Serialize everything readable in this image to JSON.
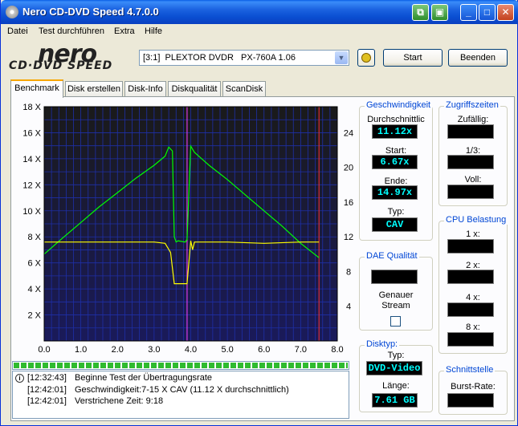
{
  "window": {
    "title": "Nero CD-DVD Speed 4.7.0.0"
  },
  "menu": [
    "Datei",
    "Test durchführen",
    "Extra",
    "Hilfe"
  ],
  "logo": {
    "line1": "nero",
    "line2": "CD·DVD SPEED"
  },
  "toolbar": {
    "drive": "[3:1]  PLEXTOR DVDR   PX-760A 1.06",
    "start": "Start",
    "quit": "Beenden"
  },
  "tabs": [
    "Benchmark",
    "Disk erstellen",
    "Disk-Info",
    "Diskqualität",
    "ScanDisk"
  ],
  "speed": {
    "title": "Geschwindigkeit",
    "avg_label": "Durchschnittlic",
    "avg": "11.12x",
    "start_label": "Start:",
    "start": "6.67x",
    "end_label": "Ende:",
    "end": "14.97x",
    "type_label": "Typ:",
    "type": "CAV"
  },
  "access": {
    "title": "Zugriffszeiten",
    "random": "Zufällig:",
    "third": "1/3:",
    "full": "Voll:"
  },
  "cpu": {
    "title": "CPU Belastung",
    "x1": "1 x:",
    "x2": "2 x:",
    "x4": "4 x:",
    "x8": "8 x:"
  },
  "dae": {
    "title": "DAE Qualität",
    "stream_label": "Genauer\nStream"
  },
  "disc": {
    "title": "Disktyp:",
    "type_label": "Typ:",
    "type": "DVD-Video",
    "length_label": "Länge:",
    "length": "7.61 GB"
  },
  "interface": {
    "title": "Schnittstelle",
    "burst": "Burst-Rate:"
  },
  "log": [
    {
      "time": "[12:32:43]",
      "msg": "Beginne Test der Übertragungsrate"
    },
    {
      "time": "[12:42:01]",
      "msg": "Geschwindigkeit:7-15 X CAV (11.12 X durchschnittlich)"
    },
    {
      "time": "[12:42:01]",
      "msg": "Verstrichene Zeit:  9:18"
    }
  ],
  "progress": 1.0,
  "chart_data": {
    "type": "line",
    "x_ticks": [
      "0.0",
      "1.0",
      "2.0",
      "3.0",
      "4.0",
      "5.0",
      "6.0",
      "7.0",
      "8.0"
    ],
    "y_left_ticks": [
      "2 X",
      "4 X",
      "6 X",
      "8 X",
      "10 X",
      "12 X",
      "14 X",
      "16 X",
      "18 X"
    ],
    "y_right_ticks": [
      "4",
      "8",
      "12",
      "16",
      "20",
      "24"
    ],
    "xlim": [
      0,
      8.0
    ],
    "ylim_left": [
      0,
      18
    ],
    "ylim_right": [
      0,
      27
    ],
    "markers": [
      3.9,
      7.5
    ],
    "series": [
      {
        "color": "#00ff00",
        "x": [
          0.0,
          0.5,
          1.0,
          1.5,
          2.0,
          2.5,
          3.0,
          3.3,
          3.4,
          3.5,
          3.55,
          3.6,
          3.65,
          3.85,
          3.9,
          4.0,
          4.1,
          4.3,
          4.5,
          5.0,
          5.5,
          6.0,
          6.5,
          7.0,
          7.5
        ],
        "y": [
          6.67,
          7.9,
          9.1,
          10.3,
          11.4,
          12.5,
          13.5,
          14.2,
          14.9,
          14.6,
          8.0,
          7.6,
          7.7,
          7.6,
          7.8,
          14.97,
          14.5,
          14.0,
          13.5,
          12.4,
          11.2,
          10.0,
          8.8,
          7.5,
          6.4
        ]
      },
      {
        "color": "#ffff00",
        "x": [
          0.0,
          1.0,
          2.0,
          3.0,
          3.3,
          3.45,
          3.55,
          3.9,
          4.0,
          4.05,
          4.1,
          4.3,
          5.0,
          6.0,
          7.0,
          7.5
        ],
        "y": [
          7.6,
          7.6,
          7.6,
          7.6,
          7.5,
          6.8,
          4.4,
          4.4,
          7.7,
          7.0,
          7.6,
          7.6,
          7.6,
          7.5,
          7.6,
          7.6
        ]
      }
    ]
  }
}
